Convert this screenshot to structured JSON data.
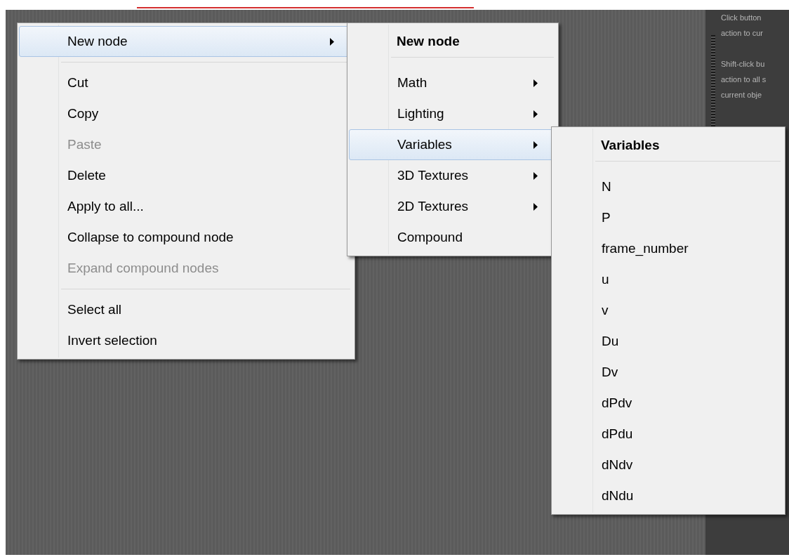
{
  "side_panel": {
    "paragraphs": [
      [
        "Click button",
        "action to cur"
      ],
      [
        "Shift-click bu",
        "action to all s",
        "current obje"
      ]
    ]
  },
  "menus": [
    {
      "items": [
        {
          "kind": "item",
          "label": "New node",
          "disabled": false,
          "selected": true,
          "submenu": true
        },
        {
          "kind": "separator"
        },
        {
          "kind": "item",
          "label": "Cut",
          "disabled": false,
          "selected": false,
          "submenu": false
        },
        {
          "kind": "item",
          "label": "Copy",
          "disabled": false,
          "selected": false,
          "submenu": false
        },
        {
          "kind": "item",
          "label": "Paste",
          "disabled": true,
          "selected": false,
          "submenu": false
        },
        {
          "kind": "item",
          "label": "Delete",
          "disabled": false,
          "selected": false,
          "submenu": false
        },
        {
          "kind": "item",
          "label": "Apply to all...",
          "disabled": false,
          "selected": false,
          "submenu": false
        },
        {
          "kind": "item",
          "label": "Collapse to compound node",
          "disabled": false,
          "selected": false,
          "submenu": false
        },
        {
          "kind": "item",
          "label": "Expand compound nodes",
          "disabled": true,
          "selected": false,
          "submenu": false
        },
        {
          "kind": "separator"
        },
        {
          "kind": "item",
          "label": "Select all",
          "disabled": false,
          "selected": false,
          "submenu": false
        },
        {
          "kind": "item",
          "label": "Invert selection",
          "disabled": false,
          "selected": false,
          "submenu": false
        }
      ]
    },
    {
      "header": "New node",
      "items": [
        {
          "kind": "item",
          "label": "Math",
          "disabled": false,
          "selected": false,
          "submenu": true
        },
        {
          "kind": "item",
          "label": "Lighting",
          "disabled": false,
          "selected": false,
          "submenu": true
        },
        {
          "kind": "item",
          "label": "Variables",
          "disabled": false,
          "selected": true,
          "submenu": true
        },
        {
          "kind": "item",
          "label": "3D Textures",
          "disabled": false,
          "selected": false,
          "submenu": true
        },
        {
          "kind": "item",
          "label": "2D Textures",
          "disabled": false,
          "selected": false,
          "submenu": true
        },
        {
          "kind": "item",
          "label": "Compound",
          "disabled": false,
          "selected": false,
          "submenu": false
        }
      ]
    },
    {
      "header": "Variables",
      "items": [
        {
          "kind": "item",
          "label": "N",
          "disabled": false,
          "selected": false,
          "submenu": false
        },
        {
          "kind": "item",
          "label": "P",
          "disabled": false,
          "selected": false,
          "submenu": false
        },
        {
          "kind": "item",
          "label": "frame_number",
          "disabled": false,
          "selected": false,
          "submenu": false
        },
        {
          "kind": "item",
          "label": "u",
          "disabled": false,
          "selected": false,
          "submenu": false
        },
        {
          "kind": "item",
          "label": "v",
          "disabled": false,
          "selected": false,
          "submenu": false
        },
        {
          "kind": "item",
          "label": "Du",
          "disabled": false,
          "selected": false,
          "submenu": false
        },
        {
          "kind": "item",
          "label": "Dv",
          "disabled": false,
          "selected": false,
          "submenu": false
        },
        {
          "kind": "item",
          "label": "dPdv",
          "disabled": false,
          "selected": false,
          "submenu": false
        },
        {
          "kind": "item",
          "label": "dPdu",
          "disabled": false,
          "selected": false,
          "submenu": false
        },
        {
          "kind": "item",
          "label": "dNdv",
          "disabled": false,
          "selected": false,
          "submenu": false
        },
        {
          "kind": "item",
          "label": "dNdu",
          "disabled": false,
          "selected": false,
          "submenu": false
        }
      ]
    }
  ]
}
